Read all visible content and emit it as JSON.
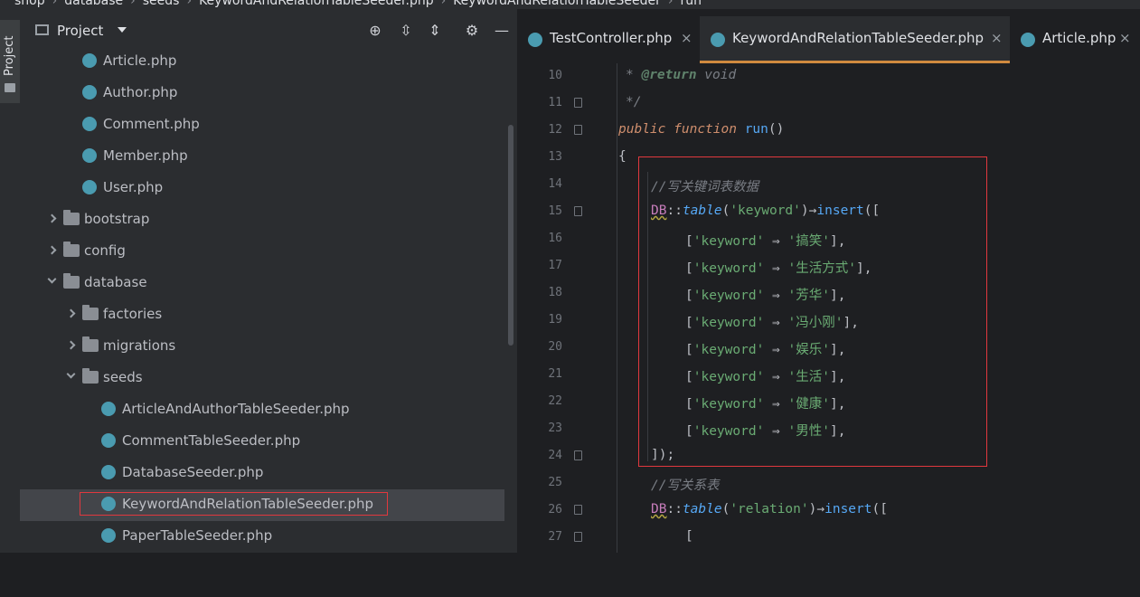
{
  "breadcrumb": [
    "shop",
    "database",
    "seeds",
    "KeywordAndRelationTableSeeder.php",
    "KeywordAndRelationTableSeeder",
    "run"
  ],
  "side_strip": {
    "label": "Project"
  },
  "project": {
    "title": "Project",
    "tree": [
      {
        "name": "Article.php",
        "type": "class"
      },
      {
        "name": "Author.php",
        "type": "class"
      },
      {
        "name": "Comment.php",
        "type": "class"
      },
      {
        "name": "Member.php",
        "type": "class"
      },
      {
        "name": "User.php",
        "type": "class"
      },
      {
        "name": "bootstrap",
        "type": "folder",
        "state": "collapsed"
      },
      {
        "name": "config",
        "type": "folder",
        "state": "collapsed"
      },
      {
        "name": "database",
        "type": "folder",
        "state": "expanded"
      },
      {
        "name": "factories",
        "type": "folder",
        "state": "collapsed"
      },
      {
        "name": "migrations",
        "type": "folder",
        "state": "collapsed"
      },
      {
        "name": "seeds",
        "type": "folder",
        "state": "expanded"
      },
      {
        "name": "ArticleAndAuthorTableSeeder.php",
        "type": "class"
      },
      {
        "name": "CommentTableSeeder.php",
        "type": "class"
      },
      {
        "name": "DatabaseSeeder.php",
        "type": "class"
      },
      {
        "name": "KeywordAndRelationTableSeeder.php",
        "type": "class",
        "selected": true
      },
      {
        "name": "PaperTableSeeder.php",
        "type": "class"
      }
    ]
  },
  "editor": {
    "tabs": [
      {
        "label": "TestController.php",
        "active": false
      },
      {
        "label": "KeywordAndRelationTableSeeder.php",
        "active": true
      },
      {
        "label": "Article.php",
        "active": false
      }
    ],
    "close_glyph": "×",
    "lines": [
      {
        "num": "10",
        "text": " * @return void"
      },
      {
        "num": "11",
        "text": " */"
      },
      {
        "num": "12",
        "text": "public function run()"
      },
      {
        "num": "13",
        "text": "{"
      },
      {
        "num": "14",
        "text": "//写关键词表数据"
      },
      {
        "num": "15",
        "text": "DB::table('keyword')->insert(["
      },
      {
        "num": "16",
        "text": "['keyword' => '搞笑'],"
      },
      {
        "num": "17",
        "text": "['keyword' => '生活方式'],"
      },
      {
        "num": "18",
        "text": "['keyword' => '芳华'],"
      },
      {
        "num": "19",
        "text": "['keyword' => '冯小刚'],"
      },
      {
        "num": "20",
        "text": "['keyword' => '娱乐'],"
      },
      {
        "num": "21",
        "text": "['keyword' => '生活'],"
      },
      {
        "num": "22",
        "text": "['keyword' => '健康'],"
      },
      {
        "num": "23",
        "text": "['keyword' => '男性'],"
      },
      {
        "num": "24",
        "text": "]);"
      },
      {
        "num": "25",
        "text": "//写关系表"
      },
      {
        "num": "26",
        "text": "DB::table('relation')->insert(["
      },
      {
        "num": "27",
        "text": "["
      }
    ],
    "tokens": {
      "star": "* ",
      "return_tag": "@return",
      "void": " void",
      "comment_end": "*/",
      "public": "public",
      "function": "function",
      "run": "run",
      "parens": "()",
      "open_brace": "{",
      "comment1": "//写关键词表数据",
      "db": "DB",
      "dcolon": "::",
      "table": "table",
      "lparen": "(",
      "keyword_table": "'keyword'",
      "arrow_insert": ")→",
      "insert": "insert",
      "open_call": "([",
      "key": "'keyword'",
      "fat_arrow": " ⇒ ",
      "open_bracket": "[",
      "close_item": "],",
      "values": [
        "'搞笑'",
        "'生活方式'",
        "'芳华'",
        "'冯小刚'",
        "'娱乐'",
        "'生活'",
        "'健康'",
        "'男性'"
      ],
      "close_call": "]);",
      "comment2": "//写关系表",
      "relation_table": "'relation'"
    }
  },
  "colors": {
    "accent": "#d08a3f",
    "highlight_box": "#e0383e",
    "string": "#6aab73",
    "keyword": "#cf8e6d",
    "function": "#56a8f5"
  }
}
